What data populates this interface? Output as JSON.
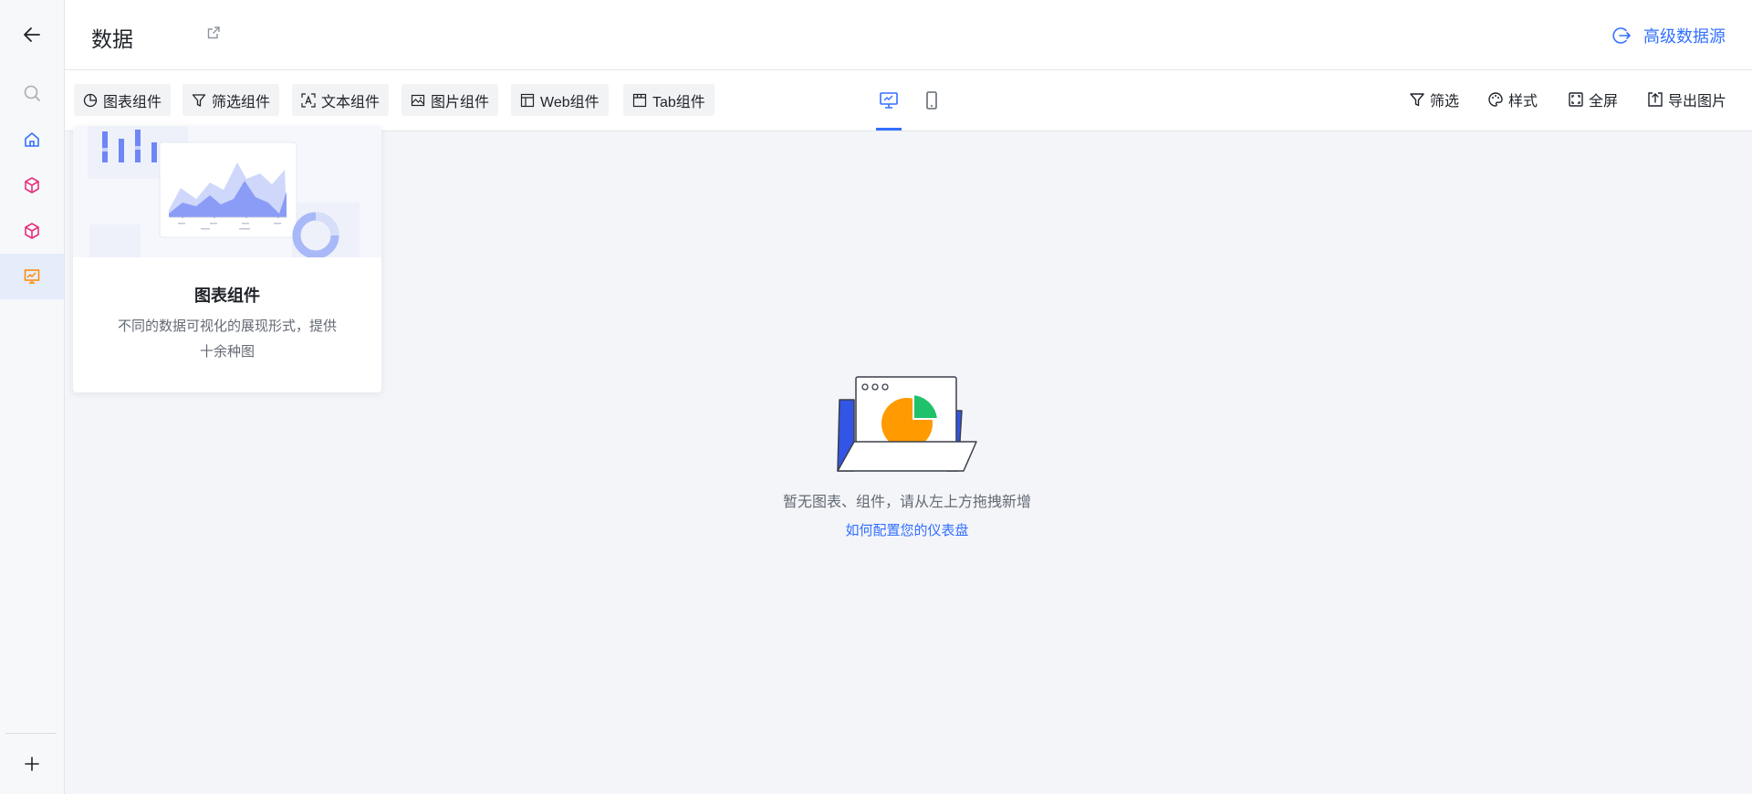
{
  "header": {
    "title": "数据",
    "advanced_source_label": "高级数据源"
  },
  "sidebar": {
    "items": [
      {
        "icon": "back-arrow-icon"
      },
      {
        "icon": "search-icon"
      },
      {
        "icon": "home-icon"
      },
      {
        "icon": "cube-icon"
      },
      {
        "icon": "cube-icon"
      },
      {
        "icon": "dashboard-icon",
        "active": true
      },
      {
        "icon": "plus-icon"
      }
    ]
  },
  "toolbar": {
    "components": [
      {
        "label": "图表组件",
        "icon": "pie-chart-icon"
      },
      {
        "label": "筛选组件",
        "icon": "filter-icon"
      },
      {
        "label": "文本组件",
        "icon": "text-icon"
      },
      {
        "label": "图片组件",
        "icon": "image-icon"
      },
      {
        "label": "Web组件",
        "icon": "layout-icon"
      },
      {
        "label": "Tab组件",
        "icon": "tab-icon"
      }
    ],
    "views": [
      {
        "icon": "desktop-icon",
        "active": true
      },
      {
        "icon": "mobile-icon",
        "active": false
      }
    ],
    "actions": [
      {
        "label": "筛选",
        "icon": "filter-icon"
      },
      {
        "label": "样式",
        "icon": "palette-icon"
      },
      {
        "label": "全屏",
        "icon": "fullscreen-icon"
      },
      {
        "label": "导出图片",
        "icon": "export-icon"
      }
    ]
  },
  "card": {
    "title": "图表组件",
    "description": "不同的数据可视化的展现形式，提供十余种图"
  },
  "empty_state": {
    "message": "暂无图表、组件，请从左上方拖拽新增",
    "link": "如何配置您的仪表盘"
  },
  "colors": {
    "accent": "#3370ff",
    "active_icon": "#ff8800",
    "cube_icon": "#e5307a",
    "pie_orange": "#ff9a00",
    "pie_green": "#1fc16b"
  }
}
